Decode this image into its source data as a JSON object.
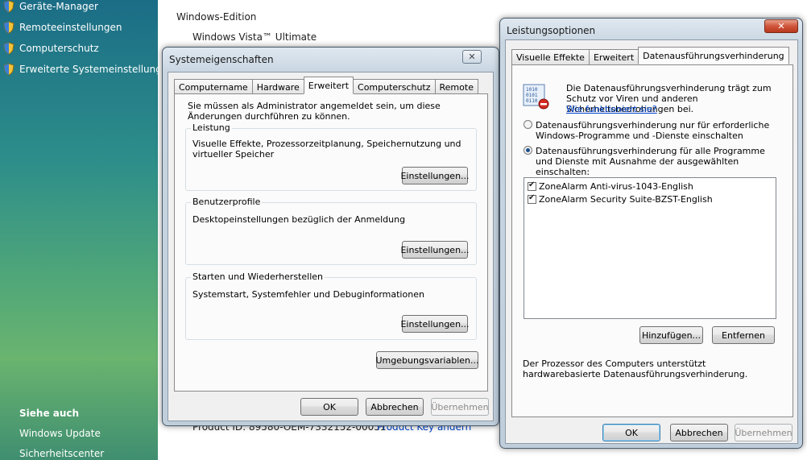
{
  "taskpane": {
    "top_items": [
      {
        "label": "Geräte-Manager"
      },
      {
        "label": "Remoteeinstellungen"
      },
      {
        "label": "Computerschutz"
      },
      {
        "label": "Erweiterte Systemeinstellungen"
      }
    ],
    "see_also_heading": "Siehe auch",
    "see_also_items": [
      "Windows Update",
      "Sicherheitscenter"
    ]
  },
  "sysinfo": {
    "edition_heading": "Windows-Edition",
    "edition_value": "Windows Vista™ Ultimate",
    "product_id_partial": "Product ID: 89580-OEM-7332152-00051",
    "change_key_link": "Product Key ändern"
  },
  "system_properties": {
    "title": "Systemeigenschaften",
    "close_symbol": "✕",
    "tabs": [
      "Computername",
      "Hardware",
      "Erweitert",
      "Computerschutz",
      "Remote"
    ],
    "active_tab": "Erweitert",
    "admin_note": "Sie müssen als Administrator angemeldet sein, um diese Änderungen durchführen zu können.",
    "performance": {
      "label": "Leistung",
      "text": "Visuelle Effekte, Prozessorzeitplanung, Speichernutzung und virtueller Speicher",
      "button": "Einstellungen..."
    },
    "user_profiles": {
      "label": "Benutzerprofile",
      "text": "Desktopeinstellungen bezüglich der Anmeldung",
      "button": "Einstellungen..."
    },
    "startup_recovery": {
      "label": "Starten und Wiederherstellen",
      "text": "Systemstart, Systemfehler und Debuginformationen",
      "button": "Einstellungen..."
    },
    "env_button": "Umgebungsvariablen...",
    "ok": "OK",
    "cancel": "Abbrechen",
    "apply": "Übernehmen"
  },
  "performance_options": {
    "title": "Leistungsoptionen",
    "close_symbol": "✕",
    "tabs": [
      "Visuelle Effekte",
      "Erweitert",
      "Datenausführungsverhinderung"
    ],
    "active_tab": "Datenausführungsverhinderung",
    "intro": "Die Datenausführungsverhinderung trägt zum Schutz vor Viren und anderen Sicherheitsbedrohungen bei.",
    "how_link": "Wie funktioniert sie?",
    "radio_essential": "Datenausführungsverhinderung nur für erforderliche Windows-Programme und -Dienste einschalten",
    "radio_all": "Datenausführungsverhinderung für alle Programme und Dienste mit Ausnahme der ausgewählten einschalten:",
    "selected_radio": "all",
    "exceptions": [
      {
        "label": "ZoneAlarm Anti-virus-1043-English",
        "checked": true
      },
      {
        "label": "ZoneAlarm Security Suite-BZST-English",
        "checked": true
      }
    ],
    "add_button": "Hinzufügen...",
    "remove_button": "Entfernen",
    "processor_note": "Der Prozessor des Computers unterstützt hardwarebasierte Datenausführungsverhinderung.",
    "ok": "OK",
    "cancel": "Abbrechen",
    "apply": "Übernehmen"
  }
}
